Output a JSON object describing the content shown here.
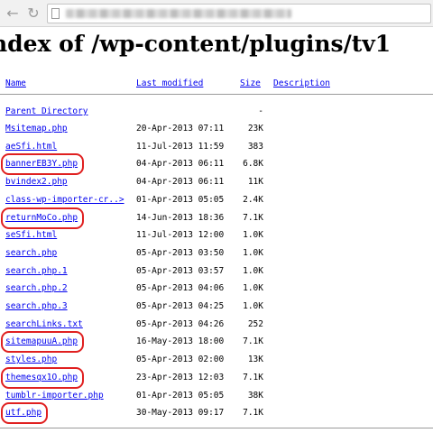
{
  "header": {
    "title": "ndex of /wp-content/plugins/tv1"
  },
  "columns": {
    "name": "Name",
    "last_modified": "Last modified",
    "size": "Size",
    "description": "Description"
  },
  "parent": {
    "label": "Parent Directory",
    "size": "-"
  },
  "files": [
    {
      "name": "Msitemap.php",
      "date": "20-Apr-2013 07:11",
      "size": "23K",
      "highlighted": false
    },
    {
      "name": "aeSfi.html",
      "date": "11-Jul-2013 11:59",
      "size": "383",
      "highlighted": false
    },
    {
      "name": "bannerEB3Y.php",
      "date": "04-Apr-2013 06:11",
      "size": "6.8K",
      "highlighted": true
    },
    {
      "name": "bvindex2.php",
      "date": "04-Apr-2013 06:11",
      "size": "11K",
      "highlighted": false
    },
    {
      "name": "class-wp-importer-cr..>",
      "date": "01-Apr-2013 05:05",
      "size": "2.4K",
      "highlighted": false
    },
    {
      "name": "returnMoCo.php",
      "date": "14-Jun-2013 18:36",
      "size": "7.1K",
      "highlighted": true
    },
    {
      "name": "seSfi.html",
      "date": "11-Jul-2013 12:00",
      "size": "1.0K",
      "highlighted": false
    },
    {
      "name": "search.php",
      "date": "05-Apr-2013 03:50",
      "size": "1.0K",
      "highlighted": false
    },
    {
      "name": "search.php.1",
      "date": "05-Apr-2013 03:57",
      "size": "1.0K",
      "highlighted": false
    },
    {
      "name": "search.php.2",
      "date": "05-Apr-2013 04:06",
      "size": "1.0K",
      "highlighted": false
    },
    {
      "name": "search.php.3",
      "date": "05-Apr-2013 04:25",
      "size": "1.0K",
      "highlighted": false
    },
    {
      "name": "searchLinks.txt",
      "date": "05-Apr-2013 04:26",
      "size": "252",
      "highlighted": false
    },
    {
      "name": "sitemapuuA.php",
      "date": "16-May-2013 18:00",
      "size": "7.1K",
      "highlighted": true
    },
    {
      "name": "styles.php",
      "date": "05-Apr-2013 02:00",
      "size": "13K",
      "highlighted": false
    },
    {
      "name": "themesqx1O.php",
      "date": "23-Apr-2013 12:03",
      "size": "7.1K",
      "highlighted": true
    },
    {
      "name": "tumblr-importer.php",
      "date": "01-Apr-2013 05:05",
      "size": "38K",
      "highlighted": false
    },
    {
      "name": "utf.php",
      "date": "30-May-2013 09:17",
      "size": "7.1K",
      "highlighted": true
    }
  ],
  "colors": {
    "link": "#0000ee",
    "highlight": "#e02020",
    "toolbar": "#f1f1f1"
  },
  "icons": {
    "back": "back-arrow-icon",
    "reload": "reload-icon",
    "page": "page-icon"
  }
}
